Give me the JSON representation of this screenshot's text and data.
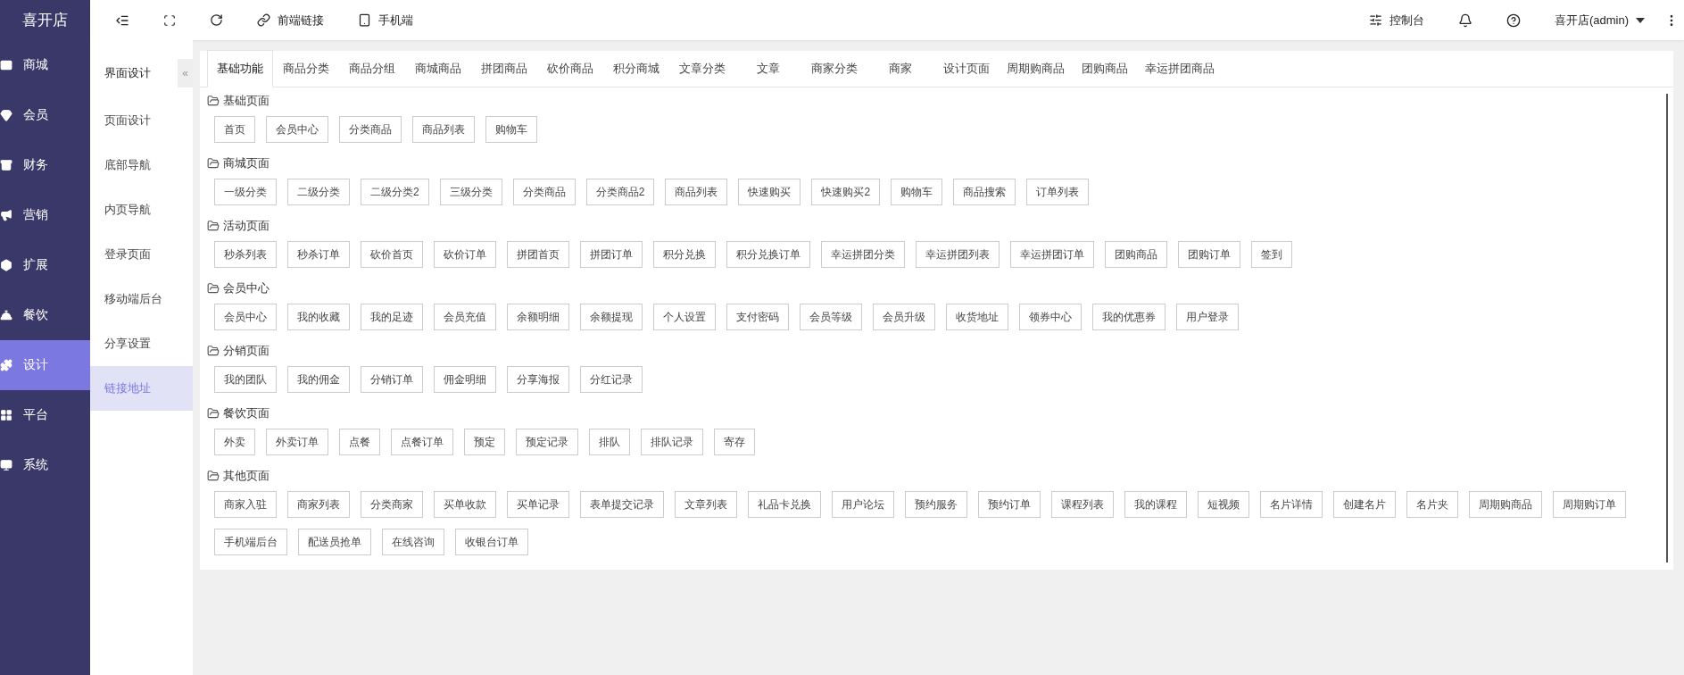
{
  "brand": "喜开店",
  "toolbar": {
    "links": [
      "前端链接",
      "手机端"
    ],
    "console": "控制台",
    "user": "喜开店(admin)"
  },
  "nav": [
    {
      "label": "商城",
      "selected": false
    },
    {
      "label": "会员",
      "selected": false
    },
    {
      "label": "财务",
      "selected": false
    },
    {
      "label": "营销",
      "selected": false
    },
    {
      "label": "扩展",
      "selected": false
    },
    {
      "label": "餐饮",
      "selected": false
    },
    {
      "label": "设计",
      "selected": true
    },
    {
      "label": "平台",
      "selected": false
    },
    {
      "label": "系统",
      "selected": false
    }
  ],
  "subnav": {
    "title": "界面设计",
    "collapse": "«",
    "items": [
      {
        "label": "页面设计",
        "selected": false
      },
      {
        "label": "底部导航",
        "selected": false
      },
      {
        "label": "内页导航",
        "selected": false
      },
      {
        "label": "登录页面",
        "selected": false
      },
      {
        "label": "移动端后台",
        "selected": false
      },
      {
        "label": "分享设置",
        "selected": false
      },
      {
        "label": "链接地址",
        "selected": true
      }
    ]
  },
  "tabs": [
    {
      "label": "基础功能",
      "selected": true
    },
    {
      "label": "商品分类",
      "selected": false
    },
    {
      "label": "商品分组",
      "selected": false
    },
    {
      "label": "商城商品",
      "selected": false
    },
    {
      "label": "拼团商品",
      "selected": false
    },
    {
      "label": "砍价商品",
      "selected": false
    },
    {
      "label": "积分商城",
      "selected": false
    },
    {
      "label": "文章分类",
      "selected": false
    },
    {
      "label": "文章",
      "selected": false
    },
    {
      "label": "商家分类",
      "selected": false
    },
    {
      "label": "商家",
      "selected": false
    },
    {
      "label": "设计页面",
      "selected": false
    },
    {
      "label": "周期购商品",
      "selected": false
    },
    {
      "label": "团购商品",
      "selected": false
    },
    {
      "label": "幸运拼团商品",
      "selected": false
    }
  ],
  "sections": [
    {
      "title": "基础页面",
      "links": [
        "首页",
        "会员中心",
        "分类商品",
        "商品列表",
        "购物车"
      ]
    },
    {
      "title": "商城页面",
      "links": [
        "一级分类",
        "二级分类",
        "二级分类2",
        "三级分类",
        "分类商品",
        "分类商品2",
        "商品列表",
        "快速购买",
        "快速购买2",
        "购物车",
        "商品搜索",
        "订单列表"
      ]
    },
    {
      "title": "活动页面",
      "links": [
        "秒杀列表",
        "秒杀订单",
        "砍价首页",
        "砍价订单",
        "拼团首页",
        "拼团订单",
        "积分兑换",
        "积分兑换订单",
        "幸运拼团分类",
        "幸运拼团列表",
        "幸运拼团订单",
        "团购商品",
        "团购订单",
        "签到"
      ]
    },
    {
      "title": "会员中心",
      "links": [
        "会员中心",
        "我的收藏",
        "我的足迹",
        "会员充值",
        "余额明细",
        "余额提现",
        "个人设置",
        "支付密码",
        "会员等级",
        "会员升级",
        "收货地址",
        "领券中心",
        "我的优惠券",
        "用户登录"
      ]
    },
    {
      "title": "分销页面",
      "links": [
        "我的团队",
        "我的佣金",
        "分销订单",
        "佣金明细",
        "分享海报",
        "分红记录"
      ]
    },
    {
      "title": "餐饮页面",
      "links": [
        "外卖",
        "外卖订单",
        "点餐",
        "点餐订单",
        "预定",
        "预定记录",
        "排队",
        "排队记录",
        "寄存"
      ]
    },
    {
      "title": "其他页面",
      "links": [
        "商家入驻",
        "商家列表",
        "分类商家",
        "买单收款",
        "买单记录",
        "表单提交记录",
        "文章列表",
        "礼品卡兑换",
        "用户论坛",
        "预约服务",
        "预约订单",
        "课程列表",
        "我的课程",
        "短视频",
        "名片详情",
        "创建名片",
        "名片夹",
        "周期购商品",
        "周期购订单",
        "手机端后台",
        "配送员抢单",
        "在线咨询",
        "收银台订单"
      ]
    }
  ]
}
